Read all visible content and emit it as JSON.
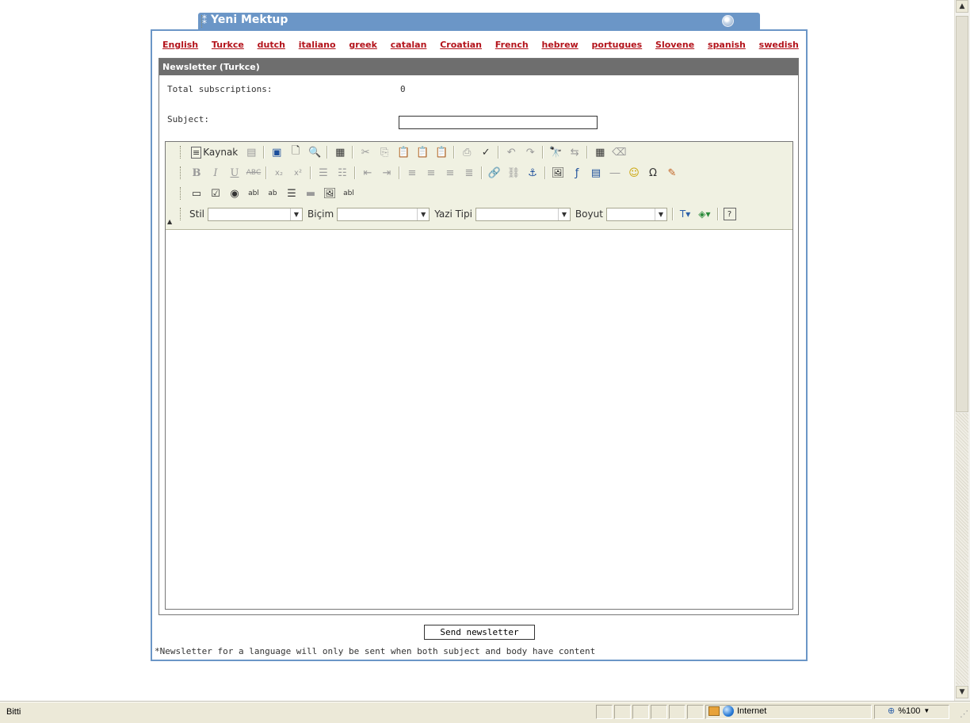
{
  "window": {
    "title": "Yeni Mektup"
  },
  "languages": [
    "English",
    "Turkce",
    "dutch",
    "italiano",
    "greek",
    "catalan",
    "Croatian",
    "French",
    "hebrew",
    "portugues",
    "Slovene",
    "spanish",
    "swedish"
  ],
  "section": {
    "title": "Newsletter (Turkce)"
  },
  "stats": {
    "total_label": "Total subscriptions:",
    "total_value": "0"
  },
  "form": {
    "subject_label": "Subject:",
    "subject_value": ""
  },
  "editor": {
    "source_label": "Kaynak",
    "style_label": "Stil",
    "format_label": "Biçim",
    "font_label": "Yazi Tipi",
    "size_label": "Boyut"
  },
  "actions": {
    "send_label": "Send newsletter"
  },
  "note": "*Newsletter for a language will only be sent when both subject and body have content",
  "statusbar": {
    "status": "Bitti",
    "zone": "Internet",
    "zoom": "%100"
  }
}
